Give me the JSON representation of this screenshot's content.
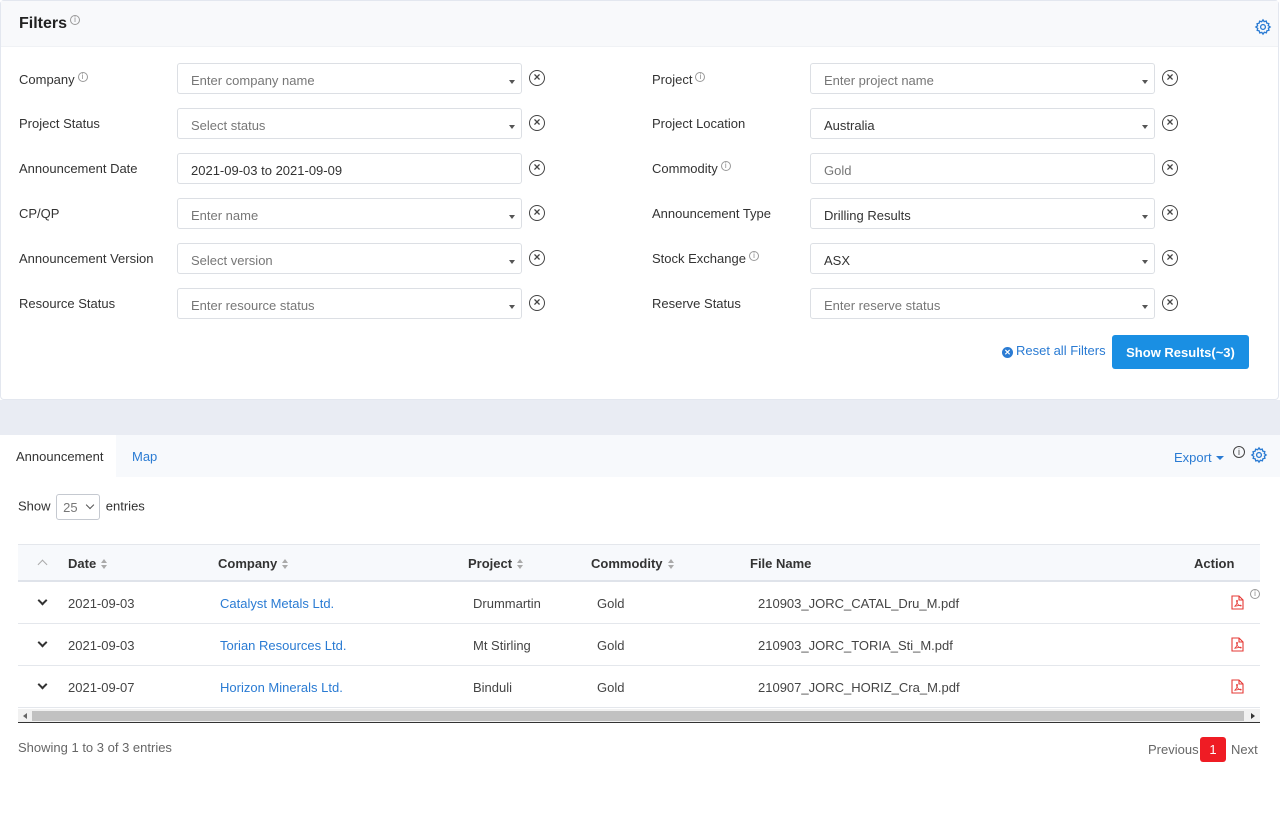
{
  "filters": {
    "title": "Filters",
    "rows": [
      {
        "label": "Company",
        "info": true,
        "placeholder": "Enter company name",
        "dropdown": true
      },
      {
        "label": "Project Status",
        "info": false,
        "placeholder": "Select status",
        "dropdown": true
      },
      {
        "label": "Announcement Date",
        "info": false,
        "value": "2021-09-03 to 2021-09-09",
        "dropdown": false
      },
      {
        "label": "CP/QP",
        "info": false,
        "placeholder": "Enter name",
        "dropdown": true
      },
      {
        "label": "Announcement Version",
        "info": false,
        "placeholder": "Select version",
        "dropdown": true
      },
      {
        "label": "Resource Status",
        "info": false,
        "placeholder": "Enter resource status",
        "dropdown": true
      }
    ],
    "rows_right": [
      {
        "label": "Project",
        "info": true,
        "placeholder": "Enter project name",
        "dropdown": true
      },
      {
        "label": "Project Location",
        "info": false,
        "value": "Australia",
        "dropdown": true
      },
      {
        "label": "Commodity",
        "info": true,
        "placeholder": "Gold",
        "dropdown": false
      },
      {
        "label": "Announcement Type",
        "info": false,
        "value": "Drilling Results",
        "dropdown": true
      },
      {
        "label": "Stock Exchange",
        "info": true,
        "value": "ASX",
        "dropdown": true
      },
      {
        "label": "Reserve Status",
        "info": false,
        "placeholder": "Enter reserve status",
        "dropdown": true
      }
    ],
    "reset_label": "Reset all Filters",
    "show_results_label": "Show Results(~3)"
  },
  "results": {
    "tabs": [
      {
        "label": "Announcement",
        "active": true
      },
      {
        "label": "Map",
        "active": false
      }
    ],
    "export_label": "Export",
    "show_label": "Show",
    "entries_value": "25",
    "entries_label": "entries",
    "columns": [
      "Date",
      "Company",
      "Project",
      "Commodity",
      "File Name",
      "Action"
    ],
    "rows": [
      {
        "date": "2021-09-03",
        "company": "Catalyst Metals Ltd.",
        "project": "Drummartin",
        "commodity": "Gold",
        "file": "210903_JORC_CATAL_Dru_M.pdf"
      },
      {
        "date": "2021-09-03",
        "company": "Torian Resources Ltd.",
        "project": "Mt Stirling",
        "commodity": "Gold",
        "file": "210903_JORC_TORIA_Sti_M.pdf"
      },
      {
        "date": "2021-09-07",
        "company": "Horizon Minerals Ltd.",
        "project": "Binduli",
        "commodity": "Gold",
        "file": "210907_JORC_HORIZ_Cra_M.pdf"
      }
    ],
    "summary": "Showing 1 to 3 of 3 entries",
    "pager": {
      "prev": "Previous",
      "current": "1",
      "next": "Next"
    }
  },
  "colors": {
    "accent": "#2a7bd3",
    "primary_button": "#1a8fe3",
    "active_page": "#ef1c24",
    "pdf_icon": "#e53935"
  },
  "icons": {
    "info": "info-icon",
    "settings": "gear-icon",
    "clear": "clear-circle-icon",
    "file": "pdf-icon"
  }
}
